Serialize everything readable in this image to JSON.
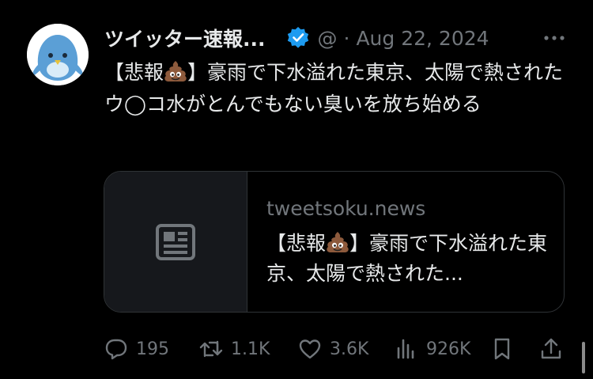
{
  "tweet": {
    "author_name": "ツイッター速報...",
    "handle": "@",
    "separator": "·",
    "date": "Aug 22, 2024",
    "text_before": "【悲報",
    "text_after": "】豪雨で下水溢れた東京、太陽で熱されたウ◯コ水がとんでもない臭いを放ち始める"
  },
  "card": {
    "domain": "tweetsoku.news",
    "title_before": "【悲報",
    "title_after": "】豪雨で下水溢れた東京、太陽で熱された..."
  },
  "actions": {
    "replies": "195",
    "reposts": "1.1K",
    "likes": "3.6K",
    "views": "926K"
  },
  "icons": [
    "bird-avatar-icon",
    "verified-badge-icon",
    "more-icon",
    "pile-of-poo-emoji",
    "newspaper-icon",
    "reply-icon",
    "repost-icon",
    "like-icon",
    "views-icon",
    "bookmark-icon",
    "share-icon"
  ],
  "colors": {
    "background": "#000000",
    "text": "#e7e9ea",
    "muted": "#71767b",
    "verified": "#1d9bf0",
    "border": "#2f3336"
  }
}
